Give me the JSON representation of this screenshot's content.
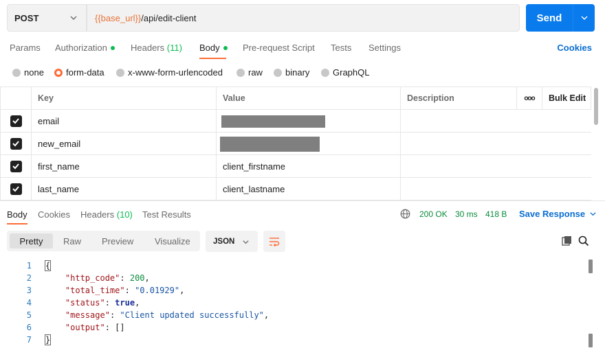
{
  "request": {
    "method": "POST",
    "url_var": "{{base_url}}",
    "url_path": "/api/edit-client",
    "send_label": "Send"
  },
  "req_tabs": {
    "params": "Params",
    "authorization": "Authorization",
    "headers": "Headers",
    "headers_count": "(11)",
    "body": "Body",
    "prerequest": "Pre-request Script",
    "tests": "Tests",
    "settings": "Settings",
    "cookies": "Cookies"
  },
  "body_types": [
    "none",
    "form-data",
    "x-www-form-urlencoded",
    "raw",
    "binary",
    "GraphQL"
  ],
  "body_type_selected": "form-data",
  "table": {
    "headers": {
      "key": "Key",
      "value": "Value",
      "description": "Description",
      "more": "ooo",
      "bulk_edit": "Bulk Edit"
    },
    "rows": [
      {
        "key": "email",
        "value": ""
      },
      {
        "key": "new_email",
        "value": ""
      },
      {
        "key": "first_name",
        "value": "client_firstname"
      },
      {
        "key": "last_name",
        "value": "client_lastname"
      }
    ]
  },
  "response": {
    "tabs": {
      "body": "Body",
      "cookies": "Cookies",
      "headers": "Headers",
      "headers_count": "(10)",
      "test_results": "Test Results"
    },
    "status": "200 OK",
    "time": "30 ms",
    "size": "418 B",
    "save_label": "Save Response",
    "views": {
      "pretty": "Pretty",
      "raw": "Raw",
      "preview": "Preview",
      "visualize": "Visualize"
    },
    "format": "JSON",
    "code": {
      "line_numbers": [
        "1",
        "2",
        "3",
        "4",
        "5",
        "6",
        "7"
      ],
      "open_brace": "{",
      "close_brace": "}",
      "http_code_key": "\"http_code\"",
      "http_code_val": "200",
      "total_time_key": "\"total_time\"",
      "total_time_val": "\"0.01929\"",
      "status_key": "\"status\"",
      "status_val": "true",
      "message_key": "\"message\"",
      "message_val": "\"Client updated successfully\"",
      "output_key": "\"output\"",
      "output_val": "[]"
    }
  },
  "colors": {
    "accent": "#ff6c37",
    "primary": "#097bed",
    "success": "#0cbb52"
  }
}
